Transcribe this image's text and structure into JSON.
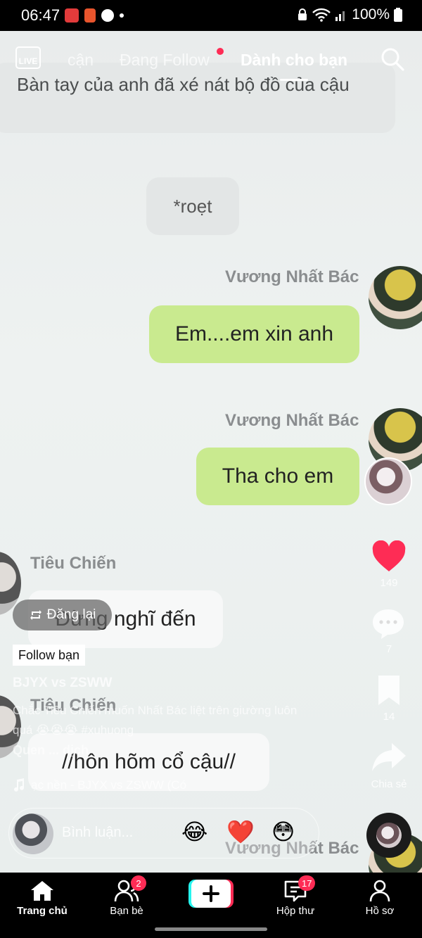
{
  "status_bar": {
    "time": "06:47",
    "battery": "100%"
  },
  "top_nav": {
    "live_label": "LIVE",
    "tabs": [
      {
        "label": "cận"
      },
      {
        "label": "Đang Follow"
      },
      {
        "label": "Dành cho bạn"
      }
    ]
  },
  "video": {
    "top_text": "Bàn tay của anh đã xé nát bộ đồ của cậu",
    "sound_text": "*roẹt",
    "messages": [
      {
        "sender": "Vương Nhất Bác",
        "text": "Em....em xin anh"
      },
      {
        "sender": "Vương Nhất Bác",
        "text": "Tha cho em"
      },
      {
        "sender": "Tiêu Chiến",
        "text": "Đừng nghĩ đến"
      },
      {
        "sender": "Tiêu Chiến",
        "text": "//hôn hõm cổ cậu//"
      },
      {
        "sender": "Vương Nhất Bác",
        "text": ""
      }
    ]
  },
  "actions": {
    "likes": "149",
    "comments": "7",
    "saves": "14",
    "share_label": "Chia sẻ"
  },
  "caption": {
    "repost_label": "Đăng lại",
    "follow_tag": "Follow bạn",
    "author": "BJYX vs ZSWW",
    "text": "Chắc Tiêu Chiến muốn Nhất Bác liệt trên giường luôn quá 😭😭😭 #xuhuong",
    "translation_hint": "Quen ... dịch",
    "music": "ạc nền - BJYX vs ZSWW (Có"
  },
  "comment_bar": {
    "placeholder": "Bình luận...",
    "emojis": [
      "😂",
      "❤️",
      "😳"
    ]
  },
  "bottom_nav": {
    "items": [
      {
        "label": "Trang chủ"
      },
      {
        "label": "Bạn bè",
        "badge": "2"
      },
      {
        "label": ""
      },
      {
        "label": "Hộp thư",
        "badge": "17"
      },
      {
        "label": "Hồ sơ"
      }
    ]
  },
  "colors": {
    "accent": "#fe2c55",
    "chat_green": "#c9ea8f",
    "cyan": "#25f4ee"
  }
}
